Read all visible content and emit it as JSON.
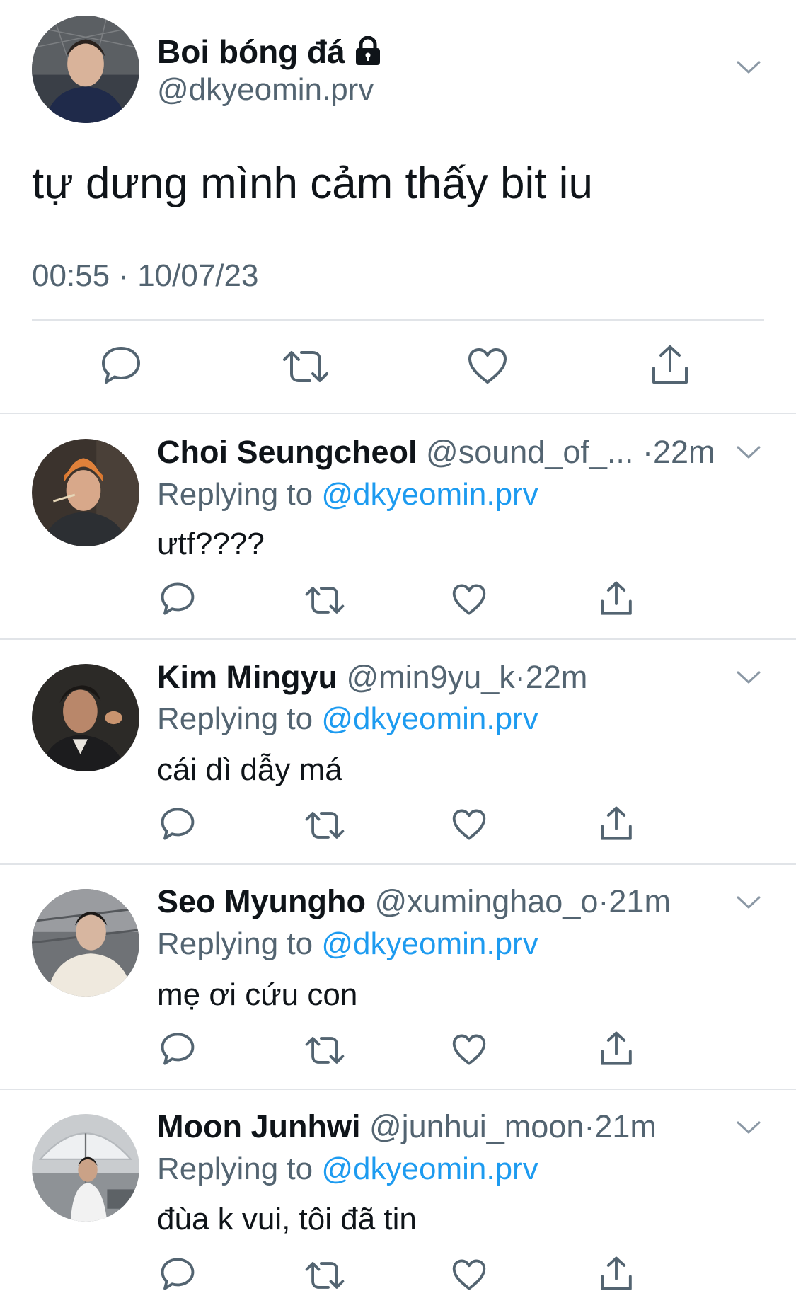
{
  "main_tweet": {
    "display_name": "Boi bóng đá",
    "handle": "@dkyeomin.prv",
    "protected_icon": "lock-icon",
    "text": "tự dưng mình cảm thấy bit iu",
    "timestamp": "00:55 · 10/07/23",
    "actions": [
      "reply-icon",
      "retweet-icon",
      "like-icon",
      "share-icon"
    ]
  },
  "replies": [
    {
      "display_name": "Choi Seungcheol",
      "handle": "@sound_of_...",
      "sep": "·",
      "time": "22m",
      "replying_label": "Replying to",
      "replying_handle": "@dkyeomin.prv",
      "text": "ưtf????"
    },
    {
      "display_name": "Kim Mingyu",
      "handle": "@min9yu_k",
      "sep": "·",
      "time": "22m",
      "replying_label": "Replying to",
      "replying_handle": "@dkyeomin.prv",
      "text": "cái dì dẫy má"
    },
    {
      "display_name": "Seo Myungho",
      "handle": "@xuminghao_o",
      "sep": "·",
      "time": "21m",
      "replying_label": "Replying to",
      "replying_handle": "@dkyeomin.prv",
      "text": "mẹ ơi cứu con"
    },
    {
      "display_name": "Moon Junhwi",
      "handle": "@junhui_moon",
      "sep": "·",
      "time": "21m",
      "replying_label": "Replying to",
      "replying_handle": "@dkyeomin.prv",
      "text": "đùa k vui, tôi đã tin"
    }
  ],
  "colors": {
    "text": "#0f1419",
    "secondary": "#536471",
    "link": "#1d9bf0",
    "divider": "#e1e4e8",
    "icon": "#536471"
  }
}
